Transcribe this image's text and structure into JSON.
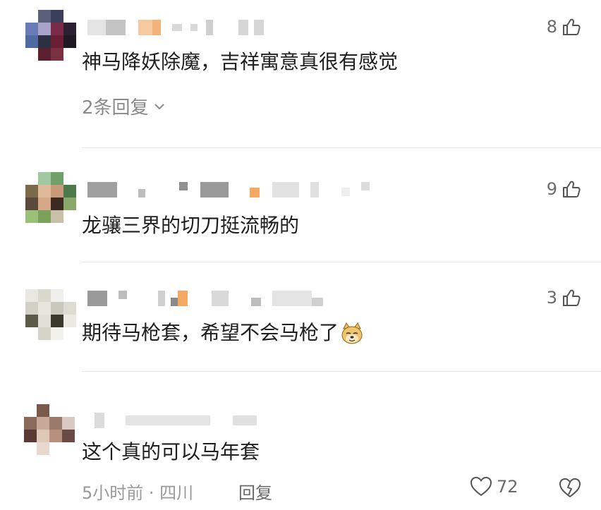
{
  "comments": [
    {
      "text": "神马降妖除魔，吉祥寓意真很有感觉",
      "likes": "8",
      "replies_label": "2条回复"
    },
    {
      "text": "龙骧三界的切刀挺流畅的",
      "likes": "9"
    },
    {
      "text": "期待马枪套，希望不会马枪了",
      "likes": "3"
    },
    {
      "text": "这个真的可以马年套",
      "time": "5小时前",
      "location": "四川",
      "reply_label": "回复",
      "likes": "72"
    }
  ],
  "colors": {
    "text": "#1f1f1f",
    "muted": "#9a9a9a",
    "divider": "#e8e8e8"
  }
}
